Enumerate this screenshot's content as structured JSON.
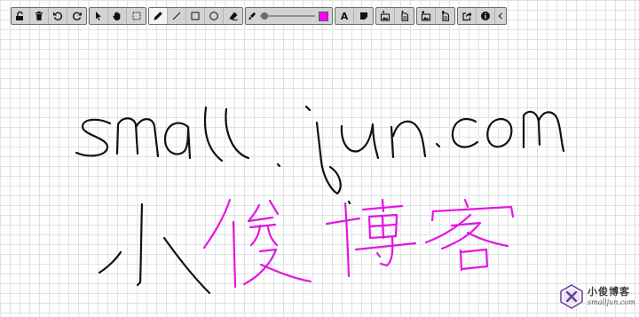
{
  "toolbar": {
    "groups": [
      {
        "name": "history",
        "buttons": [
          "unlock-icon",
          "trash-icon",
          "undo-icon",
          "redo-icon"
        ]
      },
      {
        "name": "mode",
        "buttons": [
          "cursor-icon",
          "hand-icon",
          "select-box-icon"
        ]
      },
      {
        "name": "draw",
        "buttons": [
          "pencil-icon",
          "line-icon",
          "rectangle-icon",
          "circle-icon",
          "eraser-icon"
        ]
      },
      {
        "name": "text",
        "buttons": [
          "text-icon",
          "sticky-note-icon"
        ]
      },
      {
        "name": "file",
        "buttons": [
          "export-image-icon",
          "export-document-icon"
        ]
      },
      {
        "name": "file2",
        "buttons": [
          "import-image-icon",
          "import-document-icon"
        ]
      },
      {
        "name": "misc",
        "buttons": [
          "share-icon",
          "info-icon",
          "collapse-icon"
        ]
      }
    ],
    "text_button_label": "A",
    "active_tool": "pencil",
    "stroke_width_level": 0.08,
    "stroke_color": "#ff00ff"
  },
  "canvas": {
    "background_color": "#ffffff",
    "grid_color": "#dfe3e6",
    "ink_black": "#111111",
    "ink_magenta": "#e316e3",
    "handwriting_line1": "smalljun.com",
    "handwriting_line2": "小俊博客"
  },
  "watermark": {
    "title": "小俊博客",
    "subtitle": "smalljun.com",
    "accent": "#6a3a9a"
  }
}
